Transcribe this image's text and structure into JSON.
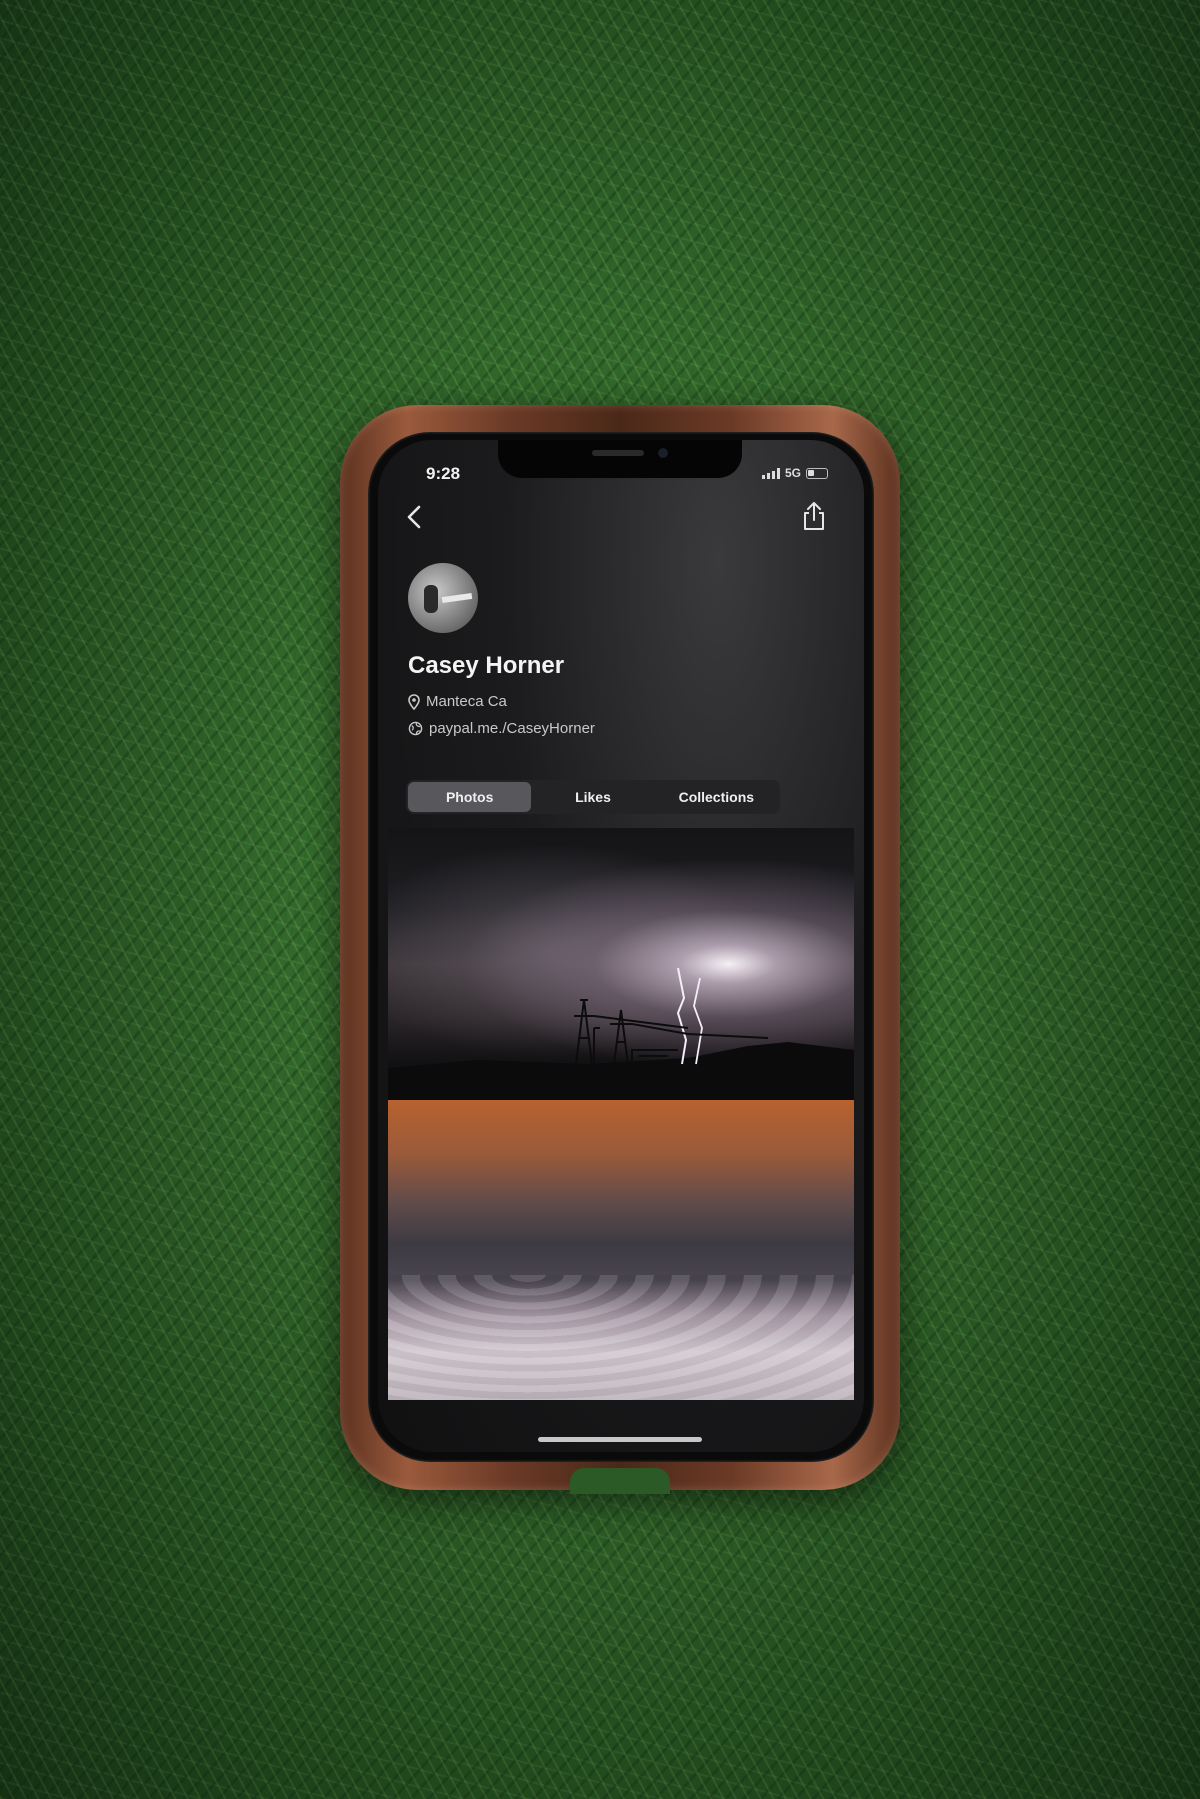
{
  "status_bar": {
    "time": "9:28",
    "network": "5G"
  },
  "profile": {
    "name": "Casey Horner",
    "location": "Manteca  Ca",
    "link": "paypal.me./CaseyHorner"
  },
  "tabs": [
    {
      "label": "Photos",
      "active": true
    },
    {
      "label": "Likes",
      "active": false
    },
    {
      "label": "Collections",
      "active": false
    }
  ],
  "icons": {
    "back": "chevron-left-icon",
    "share": "share-icon",
    "location": "location-pin-icon",
    "link": "globe-icon"
  },
  "colors": {
    "screen_bg": "#101011",
    "tab_active": "#58585c",
    "case": "#6b3a26",
    "grass": "#2e6228"
  }
}
